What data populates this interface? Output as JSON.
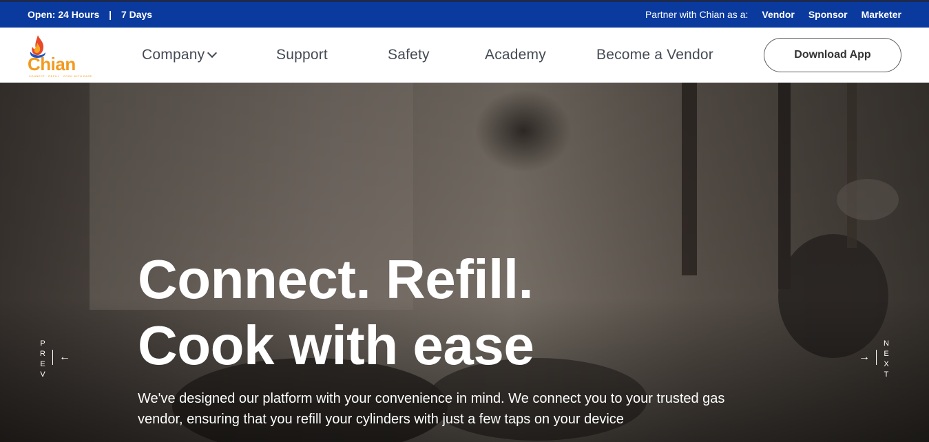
{
  "topbar": {
    "hours": "Open: 24 Hours",
    "separator": "|",
    "days": "7 Days",
    "partner_label": "Partner with Chian as a:",
    "links": [
      "Vendor",
      "Sponsor",
      "Marketer"
    ]
  },
  "logo": {
    "name": "Chian",
    "tagline": "CONNECT · REFILL · COOK WITH EASE"
  },
  "nav": {
    "items": [
      "Company",
      "Support",
      "Safety",
      "Academy",
      "Become a Vendor"
    ],
    "cta": "Download App"
  },
  "hero": {
    "title_line1": "Connect. Refill.",
    "title_line2": "Cook with ease",
    "description": "We've designed our platform with your convenience in mind. We connect you to your trusted gas vendor, ensuring that you refill your cylinders with just a few taps on your device",
    "prev_label": [
      "P",
      "R",
      "E",
      "V"
    ],
    "next_label": [
      "N",
      "E",
      "X",
      "T"
    ],
    "prev_arrow": "←",
    "next_arrow": "→"
  },
  "colors": {
    "topbar_bg": "#0a3a9e",
    "brand_orange": "#f29a1f",
    "hero_text": "#ffffff"
  },
  "icons": {
    "dropdown": "chevron-down-icon",
    "prev": "arrow-left-icon",
    "next": "arrow-right-icon"
  }
}
